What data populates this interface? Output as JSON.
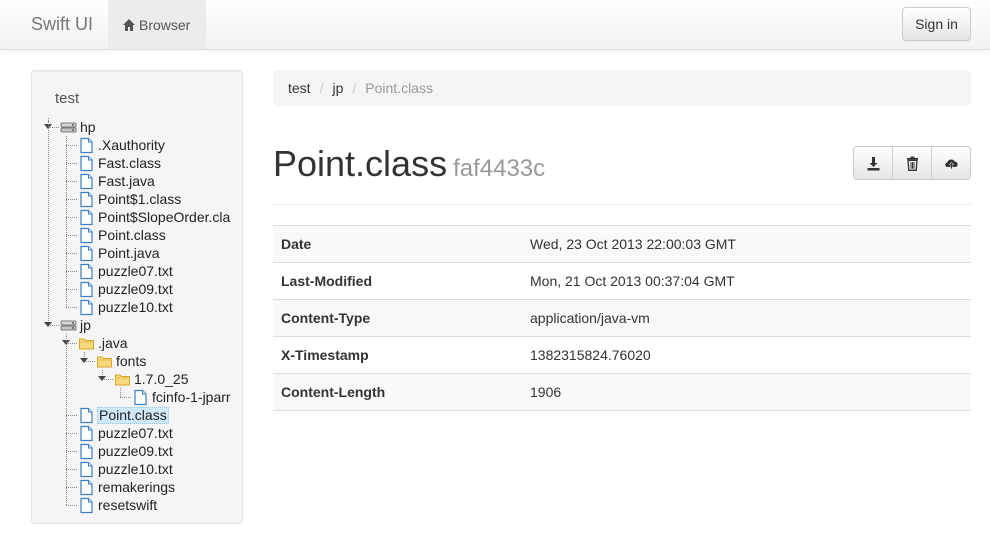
{
  "navbar": {
    "brand": "Swift UI",
    "nav_browser_label": "Browser",
    "signin_label": "Sign in"
  },
  "sidebar": {
    "title": "test",
    "tree": [
      {
        "label": "hp",
        "type": "server",
        "depth": 0,
        "expanded": true
      },
      {
        "label": ".Xauthority",
        "type": "file",
        "depth": 1
      },
      {
        "label": "Fast.class",
        "type": "file",
        "depth": 1
      },
      {
        "label": "Fast.java",
        "type": "file",
        "depth": 1
      },
      {
        "label": "Point$1.class",
        "type": "file",
        "depth": 1
      },
      {
        "label": "Point$SlopeOrder.cla",
        "type": "file",
        "depth": 1
      },
      {
        "label": "Point.class",
        "type": "file",
        "depth": 1
      },
      {
        "label": "Point.java",
        "type": "file",
        "depth": 1
      },
      {
        "label": "puzzle07.txt",
        "type": "file",
        "depth": 1
      },
      {
        "label": "puzzle09.txt",
        "type": "file",
        "depth": 1
      },
      {
        "label": "puzzle10.txt",
        "type": "file",
        "depth": 1
      },
      {
        "label": "jp",
        "type": "server",
        "depth": 0,
        "expanded": true
      },
      {
        "label": ".java",
        "type": "folder",
        "depth": 1,
        "expanded": true
      },
      {
        "label": "fonts",
        "type": "folder",
        "depth": 2,
        "expanded": true
      },
      {
        "label": "1.7.0_25",
        "type": "folder",
        "depth": 3,
        "expanded": true
      },
      {
        "label": "fcinfo-1-jparr",
        "type": "file",
        "depth": 4
      },
      {
        "label": "Point.class",
        "type": "file",
        "depth": 1,
        "selected": true
      },
      {
        "label": "puzzle07.txt",
        "type": "file",
        "depth": 1
      },
      {
        "label": "puzzle09.txt",
        "type": "file",
        "depth": 1
      },
      {
        "label": "puzzle10.txt",
        "type": "file",
        "depth": 1
      },
      {
        "label": "remakerings",
        "type": "file",
        "depth": 1
      },
      {
        "label": "resetswift",
        "type": "file",
        "depth": 1
      }
    ]
  },
  "breadcrumb": {
    "items": [
      "test",
      "jp"
    ],
    "active": "Point.class",
    "separator": "/"
  },
  "object": {
    "name": "Point.class",
    "etag_short": "faf4433c"
  },
  "actions": [
    {
      "name": "download-icon"
    },
    {
      "name": "trash-icon"
    },
    {
      "name": "upload-icon"
    }
  ],
  "metadata": [
    {
      "key": "Date",
      "value": "Wed, 23 Oct 2013 22:00:03 GMT"
    },
    {
      "key": "Last-Modified",
      "value": "Mon, 21 Oct 2013 00:37:04 GMT"
    },
    {
      "key": "Content-Type",
      "value": "application/java-vm"
    },
    {
      "key": "X-Timestamp",
      "value": "1382315824.76020"
    },
    {
      "key": "Content-Length",
      "value": "1906"
    }
  ],
  "colors": {
    "selected_bg": "#cfe8fc",
    "file_icon": "#3d7fc4",
    "folder_icon": "#f0c24a"
  }
}
